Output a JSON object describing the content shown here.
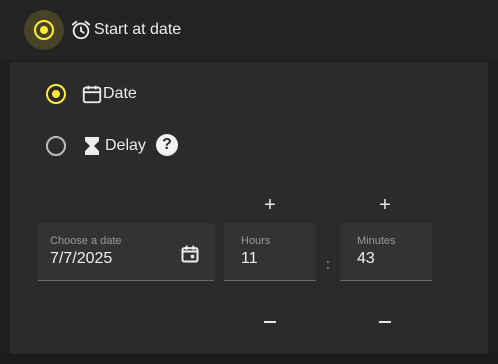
{
  "header": {
    "title": "Start at date",
    "radio_selected": true,
    "icon": "alarm-clock-icon"
  },
  "options": [
    {
      "label": "Date",
      "selected": true,
      "icon": "calendar-icon"
    },
    {
      "label": "Delay",
      "selected": false,
      "icon": "hourglass-icon",
      "help_glyph": "?"
    }
  ],
  "date_field": {
    "label": "Choose a date",
    "value": "7/7/2025",
    "icon": "calendar-picker-icon"
  },
  "hours_field": {
    "label": "Hours",
    "value": "11",
    "increment": "+",
    "decrement": "−"
  },
  "minutes_field": {
    "label": "Minutes",
    "value": "43",
    "increment": "+",
    "decrement": "−"
  },
  "separator": ":",
  "colors": {
    "accent": "#ffeb3b",
    "panel": "#2b2b2b",
    "background": "#1f1f1f"
  }
}
